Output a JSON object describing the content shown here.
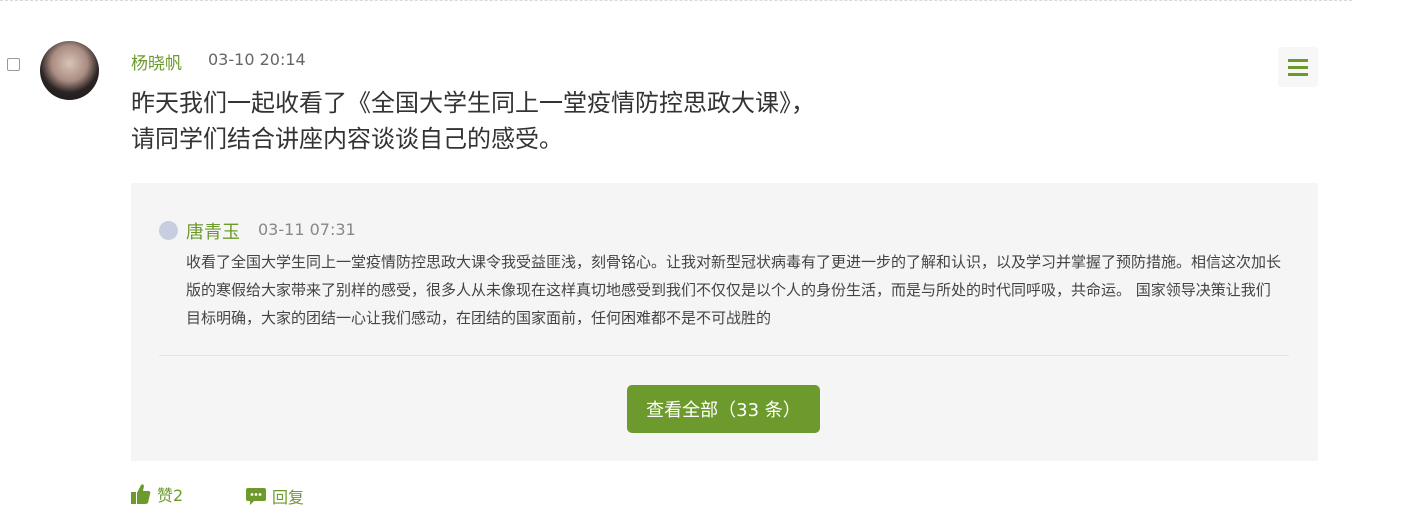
{
  "post": {
    "author": "杨晓帆",
    "time": "03-10 20:14",
    "title_line1": "昨天我们一起收看了《全国大学生同上一堂疫情防控思政大课》，",
    "title_line2": "请同学们结合讲座内容谈谈自己的感受。"
  },
  "reply": {
    "author": "唐青玉",
    "time": "03-11 07:31",
    "content": "收看了全国大学生同上一堂疫情防控思政大课令我受益匪浅，刻骨铭心。让我对新型冠状病毒有了更进一步的了解和认识，以及学习并掌握了预防措施。相信这次加长版的寒假给大家带来了别样的感受，很多人从未像现在这样真切地感受到我们不仅仅是以个人的身份生活，而是与所处的时代同呼吸，共命运。 国家领导决策让我们目标明确，大家的团结一心让我们感动，在团结的国家面前，任何困难都不是不可战胜的"
  },
  "view_all": {
    "label": "查看全部（33 条）"
  },
  "actions": {
    "like_label": "赞2",
    "reply_label": "回复"
  },
  "icons": {
    "menu": "hamburger-menu-icon",
    "like": "thumbs-up-icon",
    "reply": "chat-bubble-icon",
    "avatar": "user-avatar"
  },
  "colors": {
    "accent": "#6d9a2d",
    "reply_bg": "#f5f5f5"
  }
}
